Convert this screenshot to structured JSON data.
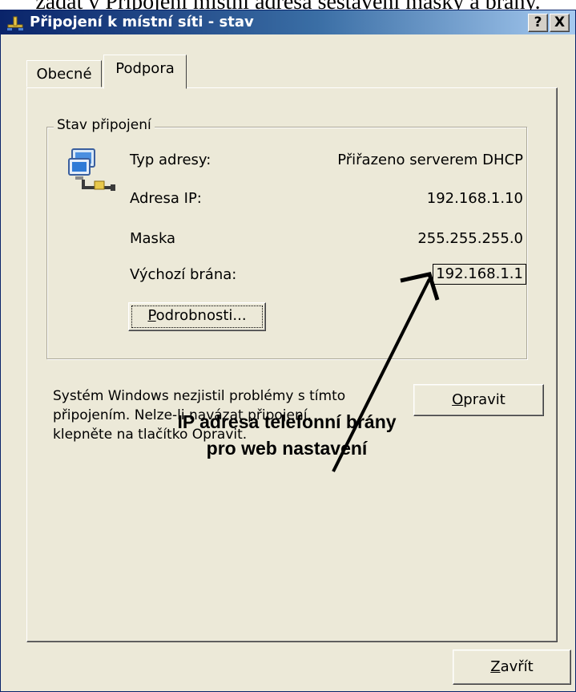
{
  "caption": {
    "text": "zadat v Připojení místní adresa sestavení masky a brány."
  },
  "window": {
    "title": "Připojení k místní síti - stav"
  },
  "titlebar_buttons": {
    "help": "?",
    "close": "X"
  },
  "tabs": [
    {
      "label": "Obecné",
      "active": false
    },
    {
      "label": "Podpora",
      "active": true
    }
  ],
  "group": {
    "legend": "Stav připojení"
  },
  "connection": {
    "rows": [
      {
        "label": "Typ adresy:",
        "value": "Přiřazeno serverem DHCP"
      },
      {
        "label": "Adresa IP:",
        "value": "192.168.1.10"
      },
      {
        "label": "Maska",
        "value": "255.255.255.0"
      },
      {
        "label": "Výchozí brána:",
        "value": "192.168.1.1"
      }
    ]
  },
  "buttons": {
    "details": {
      "underlined": "P",
      "rest": "odrobnosti..."
    },
    "repair": {
      "underlined": "O",
      "rest": "pravit"
    },
    "close": {
      "underlined": "Z",
      "rest": "avřít"
    }
  },
  "description": {
    "lines": [
      "Systém Windows nezjistil problémy s tímto",
      "připojením. Nelze-li navázat připojení,",
      "klepněte na tlačítko Opravit."
    ]
  },
  "annotation": {
    "lines": [
      "IP adresa telefonní brány",
      "pro web nastavení"
    ]
  },
  "icons": {
    "title": "network-connection-icon",
    "status": "network-computers-icon"
  },
  "colors": {
    "titlebar_start": "#0a246a",
    "titlebar_end": "#a6caf0",
    "dialog_bg": "#ece9d8"
  }
}
